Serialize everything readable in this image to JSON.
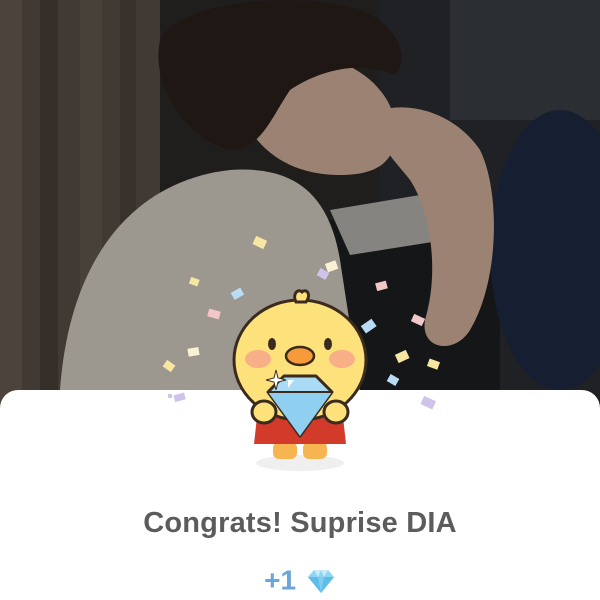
{
  "dialog": {
    "title": "Congrats! Suprise DIA",
    "reward_amount": "+1",
    "reward_icon": "diamond-icon"
  },
  "colors": {
    "title": "#5c5c5c",
    "reward": "#6aa6da",
    "sheet_background": "#ffffff"
  }
}
